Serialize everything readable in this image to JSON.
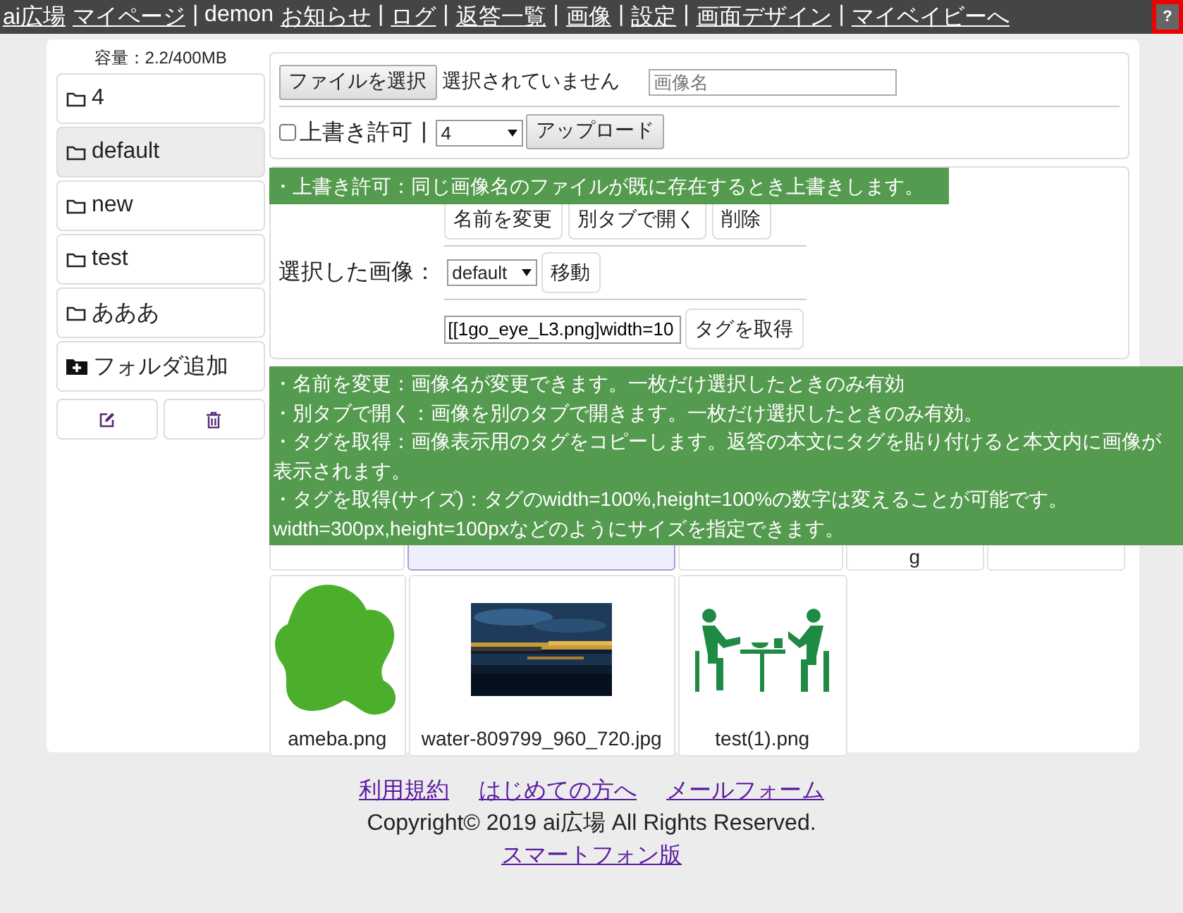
{
  "nav": {
    "items": [
      {
        "kind": "link",
        "label": "ai広場"
      },
      {
        "kind": "link",
        "label": "マイページ"
      },
      {
        "kind": "text",
        "label": "| demon"
      },
      {
        "kind": "link",
        "label": "お知らせ"
      },
      {
        "kind": "text",
        "label": "|"
      },
      {
        "kind": "link",
        "label": "ログ"
      },
      {
        "kind": "text",
        "label": "|"
      },
      {
        "kind": "link",
        "label": "返答一覧"
      },
      {
        "kind": "text",
        "label": "|"
      },
      {
        "kind": "link",
        "label": "画像"
      },
      {
        "kind": "text",
        "label": "|"
      },
      {
        "kind": "link",
        "label": "設定"
      },
      {
        "kind": "text",
        "label": "|"
      },
      {
        "kind": "link",
        "label": "画面デザイン"
      },
      {
        "kind": "text",
        "label": "|"
      },
      {
        "kind": "link",
        "label": "マイベイビーへ"
      }
    ],
    "help": "?"
  },
  "sidebar": {
    "capacity": "容量：2.2/400MB",
    "folders": [
      {
        "name": "4",
        "selected": false
      },
      {
        "name": "default",
        "selected": true
      },
      {
        "name": "new",
        "selected": false
      },
      {
        "name": "test",
        "selected": false
      },
      {
        "name": "あああ",
        "selected": false
      }
    ],
    "add_folder": "フォルダ追加"
  },
  "upload": {
    "file_button": "ファイルを選択",
    "file_status": "選択されていません",
    "name_placeholder": "画像名",
    "overwrite": {
      "label": "上書き許可",
      "checked": false
    },
    "separator": "|",
    "folder_select": "4",
    "upload_button": "アップロード"
  },
  "selection": {
    "buttons": [
      "名前を変更",
      "別タブで開く",
      "削除"
    ],
    "label": "選択した画像：",
    "move_select": "default",
    "move_button": "移動",
    "tag_value": "[[1go_eye_L3.png]width=10",
    "tag_button": "タグを取得"
  },
  "tooltips": [
    {
      "lines": [
        "・上書き許可：同じ画像名のファイルが既に存在するとき上書きします。"
      ]
    },
    {
      "lines": [
        "・名前を変更：画像名が変更できます。一枚だけ選択したときのみ有効",
        "・別タブで開く：画像を別のタブで開きます。一枚だけ選択したときのみ有効。",
        "・タグを取得：画像表示用のタグをコピーします。返答の本文にタグを貼り付けると本文内に画像が表示されます。",
        "・タグを取得(サイズ)：タグのwidth=100%,height=100%の数字は変えることが可能です。width=300px,height=100pxなどのようにサイズを指定できます。"
      ]
    }
  ],
  "gallery": [
    {
      "selected": false
    },
    {
      "selected": true
    },
    {
      "selected": false
    },
    {
      "selected": false,
      "name": "g"
    },
    {
      "selected": false
    },
    {
      "selected": false,
      "kind": "blob",
      "name": "ameba.png"
    },
    {
      "selected": false,
      "kind": "picture",
      "name": "water-809799_960_720.jpg"
    },
    {
      "selected": false,
      "kind": "dining",
      "name": "test(1).png"
    }
  ],
  "footer": {
    "links": [
      "利用規約",
      "はじめての方へ",
      "メールフォーム"
    ],
    "copyright": "Copyright© 2019 ai広場 All Rights Reserved.",
    "mobile": "スマートフォン版"
  }
}
